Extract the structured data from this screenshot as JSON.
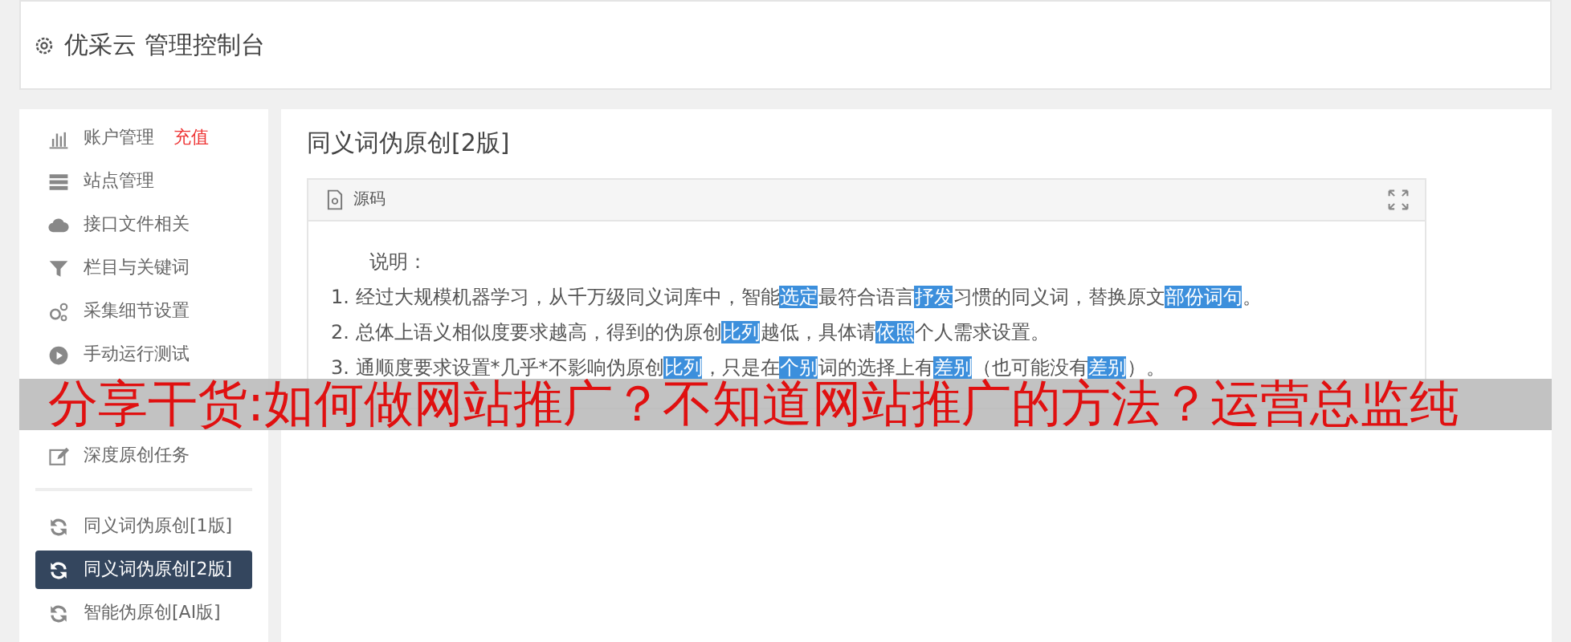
{
  "header": {
    "title": "优采云 管理控制台"
  },
  "sidebar": {
    "groups": [
      {
        "items": [
          {
            "label": "账户管理",
            "tag": "充值",
            "selected": false
          },
          {
            "label": "站点管理",
            "selected": false
          },
          {
            "label": "接口文件相关",
            "selected": false
          },
          {
            "label": "栏目与关键词",
            "selected": false
          },
          {
            "label": "采集细节设置",
            "selected": false
          },
          {
            "label": "手动运行测试",
            "selected": false
          },
          {
            "label": "深度原创任务",
            "selected": false
          }
        ]
      },
      {
        "items": [
          {
            "label": "同义词伪原创[1版]",
            "selected": false
          },
          {
            "label": "同义词伪原创[2版]",
            "selected": true
          },
          {
            "label": "智能伪原创[AI版]",
            "selected": false
          }
        ]
      }
    ]
  },
  "page_title": "同义词伪原创[2版]",
  "card": {
    "header": "源码",
    "lines": [
      {
        "kind": "heading",
        "segments": [
          {
            "text": "说明：",
            "highlighted": false
          }
        ]
      },
      {
        "kind": "item",
        "segments": [
          {
            "text": "1. 经过大规模机器学习，从千万级同义词库中，智能",
            "highlighted": false
          },
          {
            "text": "选定",
            "highlighted": true
          },
          {
            "text": "最符合语言",
            "highlighted": false
          },
          {
            "text": "抒发",
            "highlighted": true
          },
          {
            "text": "习惯的同义词，替换原文",
            "highlighted": false
          },
          {
            "text": "部份",
            "highlighted": true
          },
          {
            "text": "词句",
            "highlighted": true
          },
          {
            "text": "。",
            "highlighted": false
          }
        ]
      },
      {
        "kind": "item",
        "segments": [
          {
            "text": "2. 总体上语义相似度要求越高，得到的伪原创",
            "highlighted": false
          },
          {
            "text": "比列",
            "highlighted": true
          },
          {
            "text": "越低，具体请",
            "highlighted": false
          },
          {
            "text": "依照",
            "highlighted": true
          },
          {
            "text": "个人需求设置。",
            "highlighted": false
          }
        ]
      },
      {
        "kind": "item",
        "segments": [
          {
            "text": "3. 通顺度要求设置*几乎*不影响伪原创",
            "highlighted": false
          },
          {
            "text": "比列",
            "highlighted": true
          },
          {
            "text": "，只是在",
            "highlighted": false
          },
          {
            "text": "个别",
            "highlighted": true
          },
          {
            "text": "词的选择上有",
            "highlighted": false
          },
          {
            "text": "差别",
            "highlighted": true
          },
          {
            "text": "（也可能没有",
            "highlighted": false
          },
          {
            "text": "差别",
            "highlighted": true
          },
          {
            "text": "）。",
            "highlighted": false
          }
        ]
      }
    ]
  },
  "banner": {
    "text": "分享干货:如何做网站推广？不知道网站推广的方法？运营总监纯"
  }
}
